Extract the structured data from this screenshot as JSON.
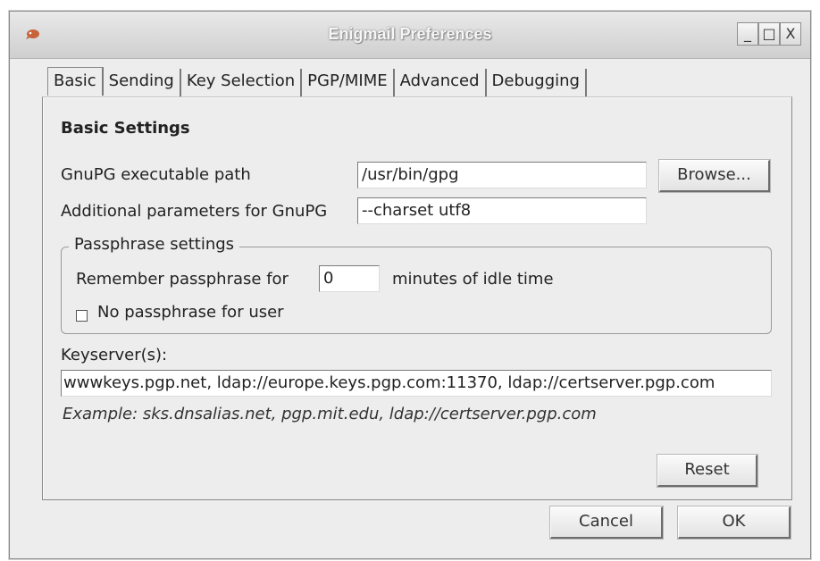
{
  "window": {
    "title": "Enigmail Preferences",
    "buttons": {
      "minimize": "_",
      "maximize": "□",
      "close": "X"
    }
  },
  "tabs": [
    {
      "label": "Basic",
      "active": true
    },
    {
      "label": "Sending",
      "active": false
    },
    {
      "label": "Key Selection",
      "active": false
    },
    {
      "label": "PGP/MIME",
      "active": false
    },
    {
      "label": "Advanced",
      "active": false
    },
    {
      "label": "Debugging",
      "active": false
    }
  ],
  "basic": {
    "section_title": "Basic Settings",
    "gpg_path_label": "GnuPG executable path",
    "gpg_path_value": "/usr/bin/gpg",
    "browse_label": "Browse...",
    "params_label": "Additional parameters for GnuPG",
    "params_value": "--charset utf8",
    "passphrase": {
      "legend": "Passphrase settings",
      "remember_label": "Remember passphrase for",
      "remember_value": "0",
      "remember_suffix": "minutes of idle time",
      "no_passphrase_label": "No passphrase for user",
      "no_passphrase_checked": false
    },
    "keyservers_label": "Keyserver(s):",
    "keyservers_value": "wwwkeys.pgp.net, ldap://europe.keys.pgp.com:11370, ldap://certserver.pgp.com",
    "example_text": "Example: sks.dnsalias.net, pgp.mit.edu, ldap://certserver.pgp.com",
    "reset_label": "Reset"
  },
  "footer": {
    "cancel_label": "Cancel",
    "ok_label": "OK"
  },
  "icons": {
    "app": "enigmail-icon",
    "checkbox": "checkbox-icon"
  },
  "colors": {
    "window_bg": "#ededed",
    "titlebar": "#cfcfcf",
    "icon_accent": "#c8643c"
  }
}
